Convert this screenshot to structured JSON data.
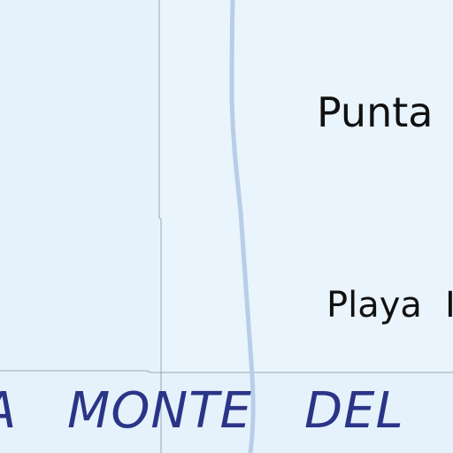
{
  "map": {
    "colors": {
      "water": "#e6f2fb",
      "grid_line": "#9aa8b4",
      "contour": "#b8cde8",
      "sea_label": "#2a3588",
      "place_label": "#111111"
    },
    "place_labels": {
      "punta": "Punta",
      "playa": "Playa"
    },
    "sea_labels": {
      "a": "A",
      "monte": "MONTE",
      "del": "DEL"
    }
  }
}
